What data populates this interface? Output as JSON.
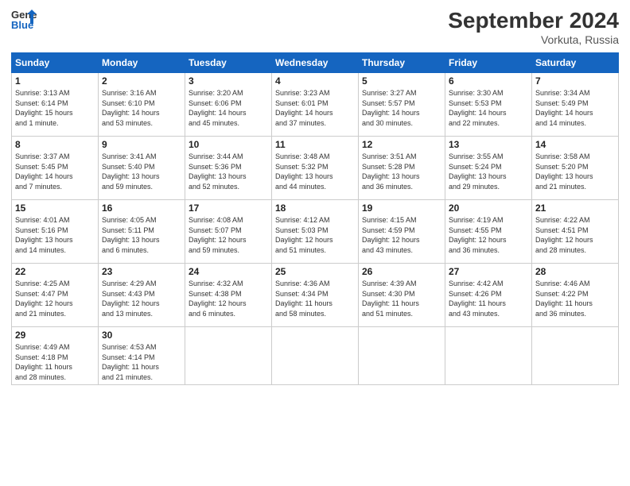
{
  "header": {
    "logo_line1": "General",
    "logo_line2": "Blue",
    "month_title": "September 2024",
    "location": "Vorkuta, Russia"
  },
  "days_of_week": [
    "Sunday",
    "Monday",
    "Tuesday",
    "Wednesday",
    "Thursday",
    "Friday",
    "Saturday"
  ],
  "weeks": [
    [
      {
        "day": "1",
        "info": "Sunrise: 3:13 AM\nSunset: 6:14 PM\nDaylight: 15 hours\nand 1 minute."
      },
      {
        "day": "2",
        "info": "Sunrise: 3:16 AM\nSunset: 6:10 PM\nDaylight: 14 hours\nand 53 minutes."
      },
      {
        "day": "3",
        "info": "Sunrise: 3:20 AM\nSunset: 6:06 PM\nDaylight: 14 hours\nand 45 minutes."
      },
      {
        "day": "4",
        "info": "Sunrise: 3:23 AM\nSunset: 6:01 PM\nDaylight: 14 hours\nand 37 minutes."
      },
      {
        "day": "5",
        "info": "Sunrise: 3:27 AM\nSunset: 5:57 PM\nDaylight: 14 hours\nand 30 minutes."
      },
      {
        "day": "6",
        "info": "Sunrise: 3:30 AM\nSunset: 5:53 PM\nDaylight: 14 hours\nand 22 minutes."
      },
      {
        "day": "7",
        "info": "Sunrise: 3:34 AM\nSunset: 5:49 PM\nDaylight: 14 hours\nand 14 minutes."
      }
    ],
    [
      {
        "day": "8",
        "info": "Sunrise: 3:37 AM\nSunset: 5:45 PM\nDaylight: 14 hours\nand 7 minutes."
      },
      {
        "day": "9",
        "info": "Sunrise: 3:41 AM\nSunset: 5:40 PM\nDaylight: 13 hours\nand 59 minutes."
      },
      {
        "day": "10",
        "info": "Sunrise: 3:44 AM\nSunset: 5:36 PM\nDaylight: 13 hours\nand 52 minutes."
      },
      {
        "day": "11",
        "info": "Sunrise: 3:48 AM\nSunset: 5:32 PM\nDaylight: 13 hours\nand 44 minutes."
      },
      {
        "day": "12",
        "info": "Sunrise: 3:51 AM\nSunset: 5:28 PM\nDaylight: 13 hours\nand 36 minutes."
      },
      {
        "day": "13",
        "info": "Sunrise: 3:55 AM\nSunset: 5:24 PM\nDaylight: 13 hours\nand 29 minutes."
      },
      {
        "day": "14",
        "info": "Sunrise: 3:58 AM\nSunset: 5:20 PM\nDaylight: 13 hours\nand 21 minutes."
      }
    ],
    [
      {
        "day": "15",
        "info": "Sunrise: 4:01 AM\nSunset: 5:16 PM\nDaylight: 13 hours\nand 14 minutes."
      },
      {
        "day": "16",
        "info": "Sunrise: 4:05 AM\nSunset: 5:11 PM\nDaylight: 13 hours\nand 6 minutes."
      },
      {
        "day": "17",
        "info": "Sunrise: 4:08 AM\nSunset: 5:07 PM\nDaylight: 12 hours\nand 59 minutes."
      },
      {
        "day": "18",
        "info": "Sunrise: 4:12 AM\nSunset: 5:03 PM\nDaylight: 12 hours\nand 51 minutes."
      },
      {
        "day": "19",
        "info": "Sunrise: 4:15 AM\nSunset: 4:59 PM\nDaylight: 12 hours\nand 43 minutes."
      },
      {
        "day": "20",
        "info": "Sunrise: 4:19 AM\nSunset: 4:55 PM\nDaylight: 12 hours\nand 36 minutes."
      },
      {
        "day": "21",
        "info": "Sunrise: 4:22 AM\nSunset: 4:51 PM\nDaylight: 12 hours\nand 28 minutes."
      }
    ],
    [
      {
        "day": "22",
        "info": "Sunrise: 4:25 AM\nSunset: 4:47 PM\nDaylight: 12 hours\nand 21 minutes."
      },
      {
        "day": "23",
        "info": "Sunrise: 4:29 AM\nSunset: 4:43 PM\nDaylight: 12 hours\nand 13 minutes."
      },
      {
        "day": "24",
        "info": "Sunrise: 4:32 AM\nSunset: 4:38 PM\nDaylight: 12 hours\nand 6 minutes."
      },
      {
        "day": "25",
        "info": "Sunrise: 4:36 AM\nSunset: 4:34 PM\nDaylight: 11 hours\nand 58 minutes."
      },
      {
        "day": "26",
        "info": "Sunrise: 4:39 AM\nSunset: 4:30 PM\nDaylight: 11 hours\nand 51 minutes."
      },
      {
        "day": "27",
        "info": "Sunrise: 4:42 AM\nSunset: 4:26 PM\nDaylight: 11 hours\nand 43 minutes."
      },
      {
        "day": "28",
        "info": "Sunrise: 4:46 AM\nSunset: 4:22 PM\nDaylight: 11 hours\nand 36 minutes."
      }
    ],
    [
      {
        "day": "29",
        "info": "Sunrise: 4:49 AM\nSunset: 4:18 PM\nDaylight: 11 hours\nand 28 minutes."
      },
      {
        "day": "30",
        "info": "Sunrise: 4:53 AM\nSunset: 4:14 PM\nDaylight: 11 hours\nand 21 minutes."
      },
      {
        "day": "",
        "info": ""
      },
      {
        "day": "",
        "info": ""
      },
      {
        "day": "",
        "info": ""
      },
      {
        "day": "",
        "info": ""
      },
      {
        "day": "",
        "info": ""
      }
    ]
  ]
}
